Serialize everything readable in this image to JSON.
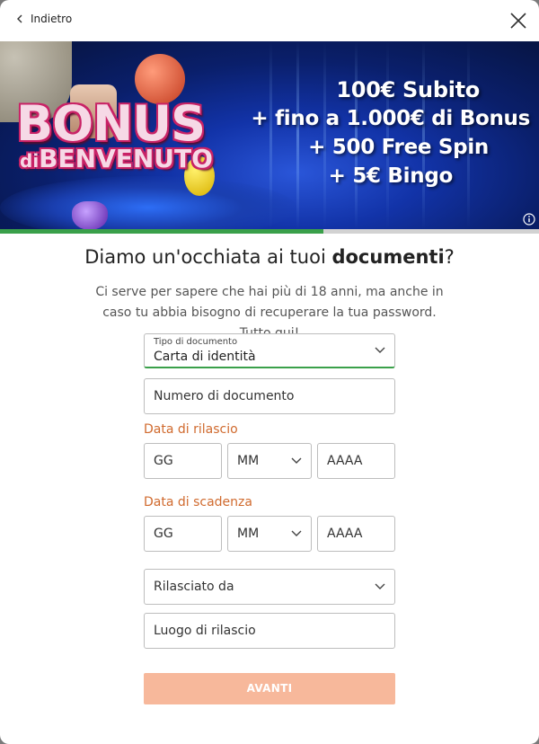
{
  "nav": {
    "back_label": "Indietro"
  },
  "banner": {
    "logo_main": "BONUS",
    "logo_sub_small": "di",
    "logo_sub": "BENVENUTO",
    "promo_lines": [
      "100€ Subito",
      "+ fino a 1.000€ di Bonus",
      "+ 500 Free Spin",
      "+ 5€ Bingo"
    ]
  },
  "progress": {
    "fraction": 0.6
  },
  "heading": {
    "pre": "Diamo un'occhiata ai tuoi ",
    "bold": "documenti",
    "post": "?"
  },
  "subtitle": "Ci serve per sapere che hai più di 18 anni, ma anche in caso tu abbia bisogno di recuperare la tua password. Tutto qui!",
  "form": {
    "doc_type": {
      "label": "Tipo di documento",
      "value": "Carta di identità"
    },
    "doc_number_placeholder": "Numero di documento",
    "issue_date": {
      "label": "Data di rilascio",
      "day": "GG",
      "month": "MM",
      "year": "AAAA"
    },
    "expiry_date": {
      "label": "Data di scadenza",
      "day": "GG",
      "month": "MM",
      "year": "AAAA"
    },
    "issued_by_placeholder": "Rilasciato da",
    "issue_place_placeholder": "Luogo di rilascio",
    "submit_label": "AVANTI"
  },
  "colors": {
    "accent_green": "#3aa04a",
    "label_orange": "#d06a2e",
    "button_disabled": "#f7b89b"
  }
}
